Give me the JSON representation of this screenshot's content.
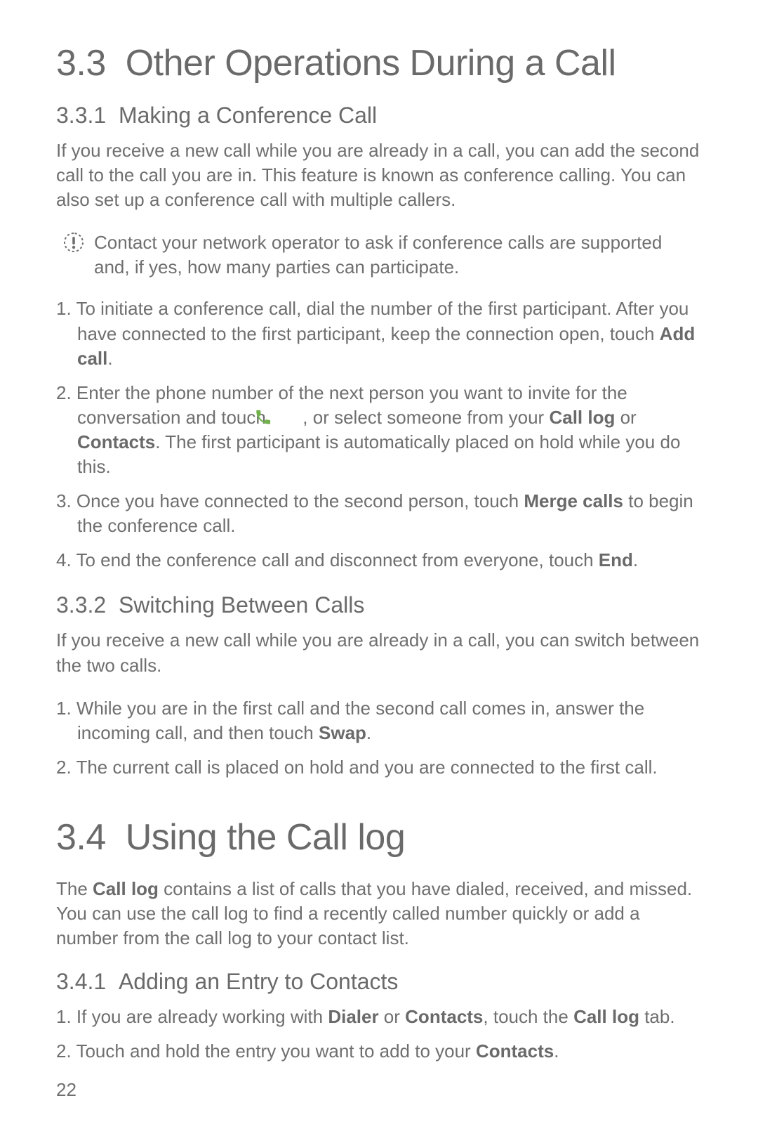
{
  "section33": {
    "number": "3.3",
    "title": "Other Operations During a Call",
    "sub1": {
      "number": "3.3.1",
      "title": "Making a Conference Call",
      "intro": "If you receive a new call while you are already in a call, you can add the second call to the call you are in. This feature is known as conference calling. You can also set up a conference call with multiple callers.",
      "note": "Contact your network operator to ask if conference calls are supported and, if yes, how many parties can participate.",
      "step1_a": "To initiate a conference call, dial the number of the first participant. After you have connected to the first participant, keep the connection open, touch ",
      "step1_b": "Add call",
      "step1_c": ".",
      "step2_a": "Enter the phone number of the next person you want to invite for the conversation and touch ",
      "step2_b": " , or select someone from your ",
      "step2_c": "Call log",
      "step2_d": " or ",
      "step2_e": "Contacts",
      "step2_f": ". The first participant is automatically placed on hold while you do this.",
      "step3_a": "Once you have connected to the second person, touch ",
      "step3_b": "Merge calls",
      "step3_c": " to begin the conference call.",
      "step4_a": "To end the conference call and disconnect from everyone, touch ",
      "step4_b": "End",
      "step4_c": "."
    },
    "sub2": {
      "number": "3.3.2",
      "title": "Switching Between Calls",
      "intro": "If you receive a new call while you are already in a call, you can switch between the two calls.",
      "step1_a": "While you are in the first call and the second call comes in, answer the incoming call, and then touch ",
      "step1_b": "Swap",
      "step1_c": ".",
      "step2": "The current call is placed on hold and you are connected to the first call."
    }
  },
  "section34": {
    "number": "3.4",
    "title": "Using the Call log",
    "intro_a": "The ",
    "intro_b": "Call log",
    "intro_c": " contains a list of calls that you have dialed, received, and missed. You can use the call log to find a recently called number quickly or add a number from the call log to your contact list.",
    "sub1": {
      "number": "3.4.1",
      "title": "Adding an Entry to Contacts",
      "step1_a": "If you are already working with ",
      "step1_b": "Dialer",
      "step1_c": " or ",
      "step1_d": "Contacts",
      "step1_e": ", touch the ",
      "step1_f": "Call log",
      "step1_g": " tab.",
      "step2_a": "Touch and hold the entry you want to add to your ",
      "step2_b": "Contacts",
      "step2_c": "."
    }
  },
  "page_number": "22"
}
